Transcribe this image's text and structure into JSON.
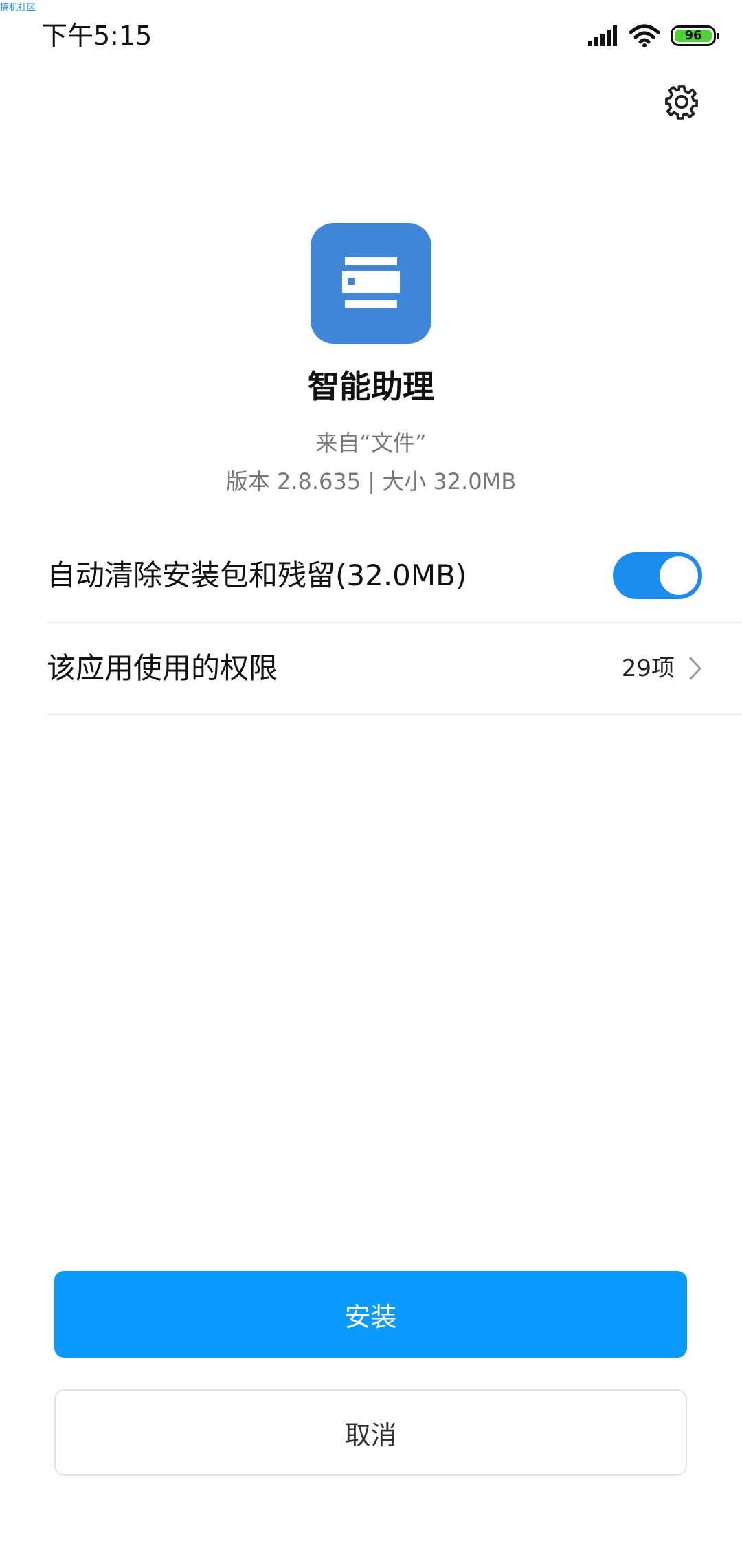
{
  "watermark": "搞机社区",
  "status_bar": {
    "time": "下午5:15",
    "battery_level": "96",
    "signal_icon": "signal-bars-icon",
    "wifi_icon": "wifi-icon"
  },
  "header": {
    "settings_icon": "gear-icon"
  },
  "app": {
    "name": "智能助理",
    "source": "来自“文件”",
    "version_info": "版本 2.8.635 | 大小 32.0MB",
    "icon_color": "#3f86d9"
  },
  "options": {
    "auto_clean": {
      "label": "自动清除安装包和残留(32.0MB)",
      "enabled": true
    },
    "permissions": {
      "label": "该应用使用的权限",
      "count": "29项"
    }
  },
  "actions": {
    "install_label": "安装",
    "cancel_label": "取消"
  },
  "colors": {
    "accent": "#0a99ff",
    "toggle_on": "#1c8cf0"
  }
}
